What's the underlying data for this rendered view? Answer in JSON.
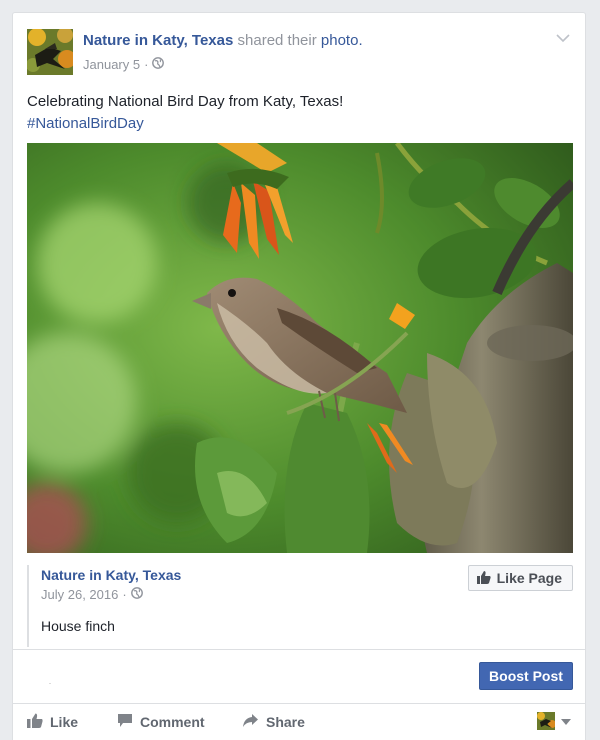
{
  "post": {
    "page_name": "Nature in Katy, Texas",
    "shared_text": "shared their",
    "photo_link": "photo.",
    "date": "January 5",
    "date_sep": "·",
    "caption": "Celebrating National Bird Day from Katy, Texas!",
    "hashtag": "#NationalBirdDay"
  },
  "shared_post": {
    "page_name": "Nature in Katy, Texas",
    "date": "July 26, 2016",
    "date_sep": "·",
    "description": "House finch",
    "like_page_label": "Like Page"
  },
  "boost_label": "Boost Post",
  "actions": {
    "like": "Like",
    "comment": "Comment",
    "share": "Share"
  },
  "icons": {
    "privacy": "globe-icon",
    "menu": "chevron-down-icon",
    "like": "thumbs-up-icon",
    "comment": "speech-bubble-icon",
    "share": "share-arrow-icon"
  },
  "colors": {
    "link": "#365899",
    "boost": "#4267b2",
    "meta": "#90949c",
    "background": "#e9ebee"
  }
}
